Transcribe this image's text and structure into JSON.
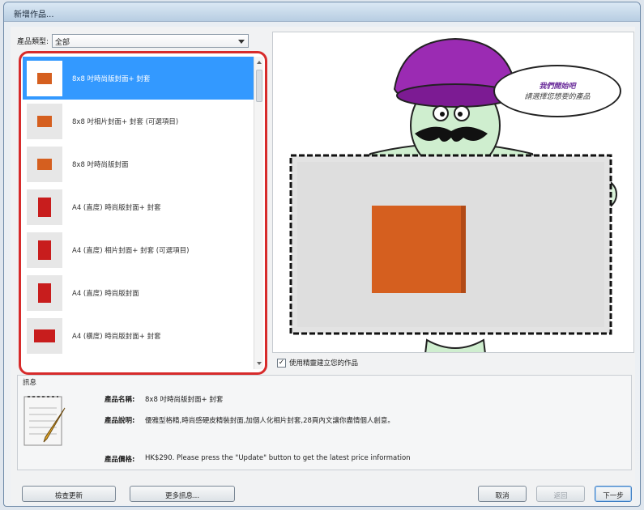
{
  "window": {
    "title": "新增作品..."
  },
  "filter": {
    "label": "產品類型:",
    "value": "全部"
  },
  "product_list": [
    {
      "label": "8x8 吋時尚版封面+ 封套",
      "thumb": "orange",
      "selected": true
    },
    {
      "label": "8x8 吋相片封面+ 封套 (可選項目)",
      "thumb": "orange",
      "selected": false
    },
    {
      "label": "8x8 吋時尚版封面",
      "thumb": "orange",
      "selected": false
    },
    {
      "label": "A4 (直度) 時尚版封面+ 封套",
      "thumb": "red",
      "selected": false
    },
    {
      "label": "A4 (直度) 相片封面+ 封套 (可選項目)",
      "thumb": "red",
      "selected": false
    },
    {
      "label": "A4 (直度) 時尚版封面",
      "thumb": "red",
      "selected": false
    },
    {
      "label": "A4 (橫度) 時尚版封面+ 封套",
      "thumb": "red-wide",
      "selected": false
    }
  ],
  "preview": {
    "speech_line1": "我們開始吧",
    "speech_line2": "請選擇您想要的產品"
  },
  "option": {
    "label": "使用精靈建立您的作品",
    "checked": true
  },
  "info": {
    "section_title": "訊息",
    "name_label": "產品名稱:",
    "name_value": "8x8 吋時尚版封面+ 封套",
    "desc_label": "產品說明:",
    "desc_value": "優雅型格精,時尚感硬皮精裝封面,加個人化相片封套,28頁內文讓你盡情個人創意。",
    "price_label": "產品價格:",
    "price_value": "HK$290. Please press the \"Update\" button to get the latest price information"
  },
  "buttons": {
    "update": "檢查更新",
    "more_info": "更多訊息...",
    "cancel": "取消",
    "back": "返回",
    "next": "下一步"
  },
  "colors": {
    "selection": "#3399ff",
    "highlight_frame": "#d72b2b",
    "cover_orange": "#d55f1f"
  }
}
